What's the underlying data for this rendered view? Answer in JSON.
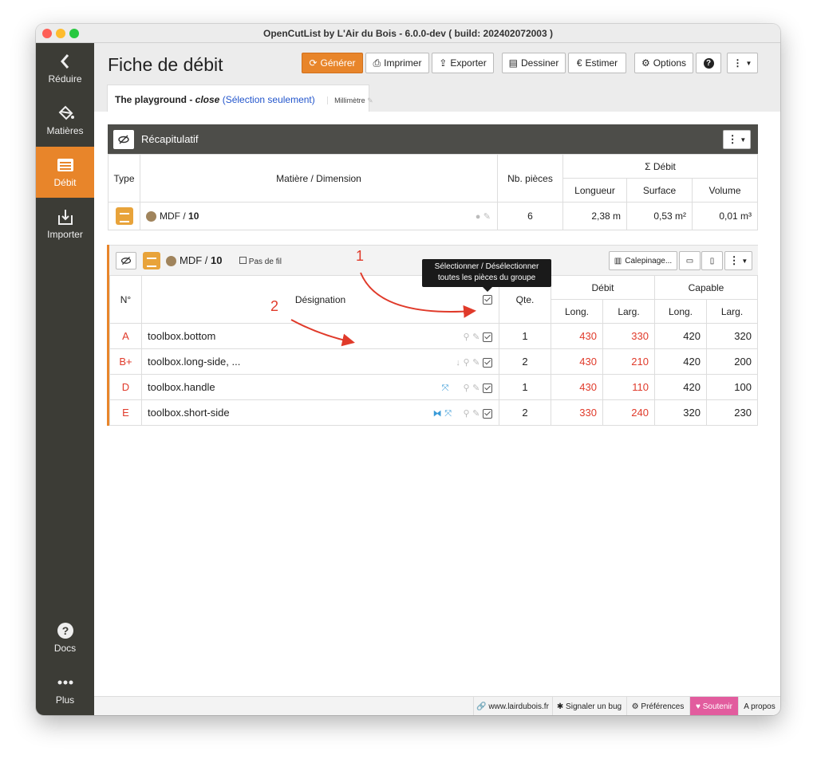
{
  "window": {
    "title": "OpenCutList by L'Air du Bois - 6.0.0-dev ( build: 202402072003 )"
  },
  "colors": {
    "accent": "#e8852a",
    "sidebar": "#3c3c36",
    "link": "#2255cc",
    "red": "#e03a2a",
    "pink": "#e25c9e"
  },
  "sidebar": {
    "items": [
      {
        "label": "Réduire",
        "icon": "chevron-left-icon"
      },
      {
        "label": "Matières",
        "icon": "paint-bucket-icon"
      },
      {
        "label": "Débit",
        "icon": "list-icon",
        "active": true
      },
      {
        "label": "Importer",
        "icon": "import-icon"
      },
      {
        "label": "Docs",
        "icon": "help-icon"
      },
      {
        "label": "Plus",
        "icon": "more-icon"
      }
    ]
  },
  "header": {
    "title": "Fiche de débit",
    "buttons": {
      "generate": "Générer",
      "print": "Imprimer",
      "export": "Exporter",
      "draw": "Dessiner",
      "estimate": "Estimer",
      "options": "Options"
    }
  },
  "tab": {
    "name": "The playground",
    "separator": " - ",
    "state": "close",
    "selection": "(Sélection seulement)",
    "unit": "Millimètre"
  },
  "summary": {
    "title": "Récapitulatif",
    "columns": {
      "type": "Type",
      "material": "Matière / Dimension",
      "count": "Nb. pièces",
      "debit": "Σ Débit",
      "length": "Longueur",
      "surface": "Surface",
      "volume": "Volume"
    },
    "row": {
      "material": "MDF",
      "sep": " / ",
      "thickness": "10",
      "count": "6",
      "length": "2,38 m",
      "surface": "0,53 m²",
      "volume": "0,01 m³"
    }
  },
  "group": {
    "material": "MDF",
    "sep": " / ",
    "thickness": "10",
    "grain": "Pas de fil",
    "calepinage": "Calepinage...",
    "columns": {
      "number": "N°",
      "designation": "Désignation",
      "qty": "Qte.",
      "debit": "Débit",
      "capable": "Capable",
      "long": "Long.",
      "larg": "Larg."
    },
    "rows": [
      {
        "number": "A",
        "name": "toolbox.bottom",
        "qty": "1",
        "debit_long": "430",
        "debit_larg": "330",
        "cap_long": "420",
        "cap_larg": "320"
      },
      {
        "number": "B+",
        "name": "toolbox.long-side, ...",
        "qty": "2",
        "debit_long": "430",
        "debit_larg": "210",
        "cap_long": "420",
        "cap_larg": "200"
      },
      {
        "number": "D",
        "name": "toolbox.handle",
        "qty": "1",
        "debit_long": "430",
        "debit_larg": "110",
        "cap_long": "420",
        "cap_larg": "100"
      },
      {
        "number": "E",
        "name": "toolbox.short-side",
        "qty": "2",
        "debit_long": "330",
        "debit_larg": "240",
        "cap_long": "320",
        "cap_larg": "230"
      }
    ]
  },
  "tooltip": {
    "line1": "Sélectionner / Désélectionner",
    "line2": "toutes les pièces du groupe"
  },
  "annotations": {
    "one": "1",
    "two": "2"
  },
  "footer": {
    "website": "www.lairdubois.fr",
    "bug": "Signaler un bug",
    "preferences": "Préférences",
    "support": "Soutenir",
    "about": "A propos"
  }
}
